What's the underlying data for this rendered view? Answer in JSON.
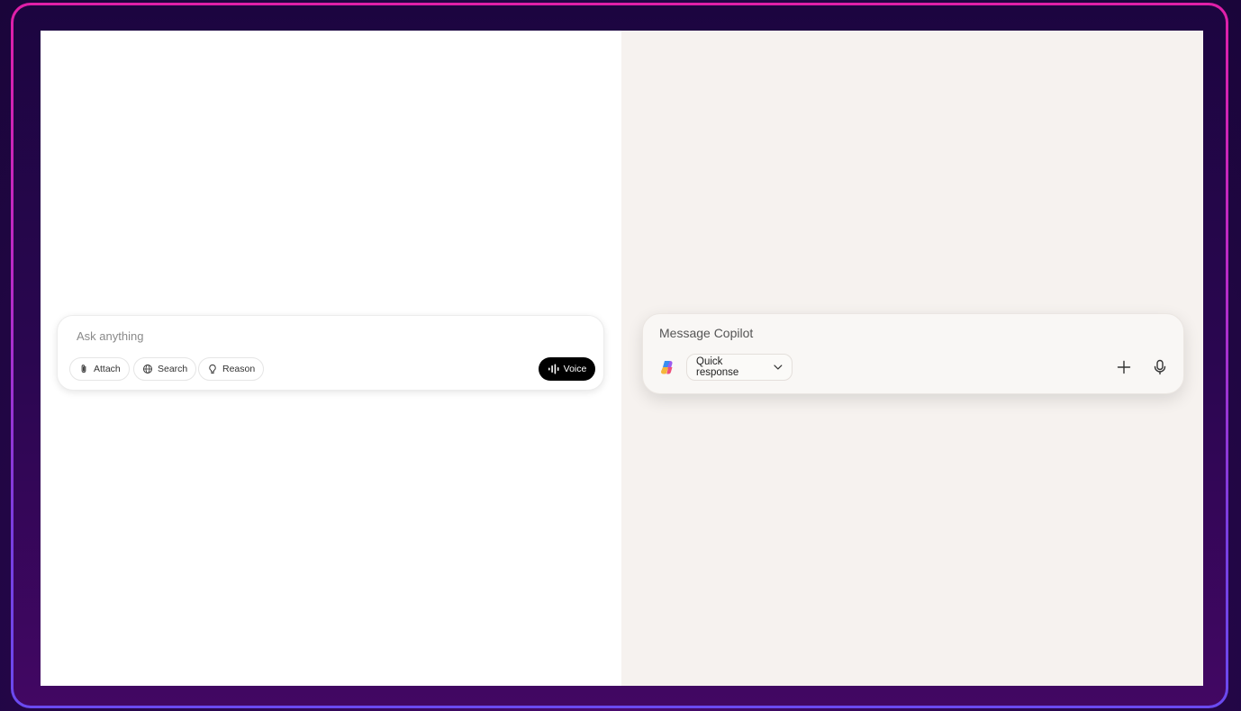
{
  "left_panel": {
    "input": {
      "placeholder": "Ask anything",
      "value": ""
    },
    "buttons": {
      "attach": "Attach",
      "search": "Search",
      "reason": "Reason",
      "voice": "Voice"
    }
  },
  "right_panel": {
    "input": {
      "placeholder": "Message Copilot",
      "value": ""
    },
    "mode_selector": "Quick response"
  },
  "icons": [
    "paperclip-icon",
    "globe-icon",
    "lightbulb-icon",
    "waveform-icon",
    "copilot-logo-icon",
    "chevron-down-icon",
    "plus-icon",
    "microphone-icon"
  ],
  "colors": {
    "frame_border_top": "#e01fa8",
    "frame_border_bottom": "#6a4af0",
    "right_pane_bg": "#f6f2ef",
    "voice_button_bg": "#000000"
  }
}
